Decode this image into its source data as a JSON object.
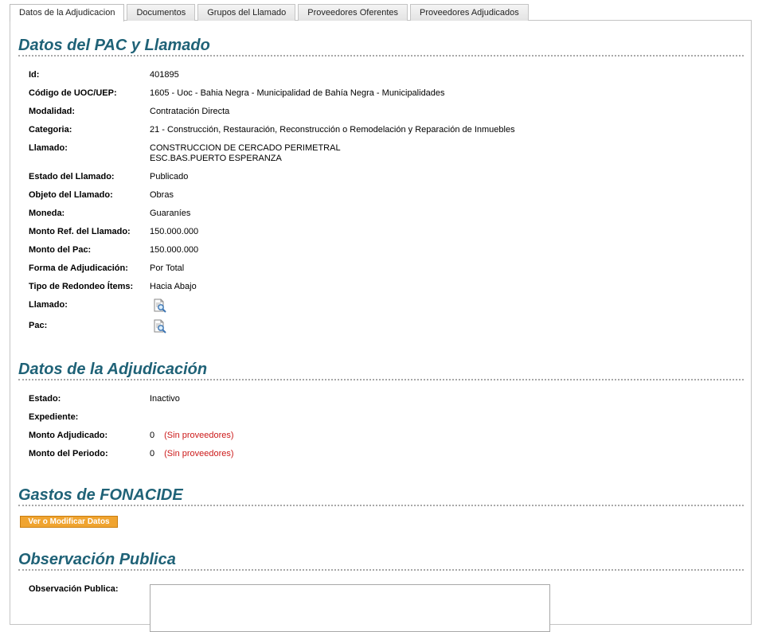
{
  "tabs": [
    {
      "label": "Datos de la Adjudicacion",
      "active": true
    },
    {
      "label": "Documentos"
    },
    {
      "label": "Grupos del Llamado"
    },
    {
      "label": "Proveedores Oferentes"
    },
    {
      "label": "Proveedores Adjudicados"
    }
  ],
  "pac": {
    "title": "Datos del PAC y Llamado",
    "fields": [
      {
        "label": "Id:",
        "value": "401895"
      },
      {
        "label": "Código de UOC/UEP:",
        "value": "1605 - Uoc - Bahia Negra - Municipalidad de Bahía Negra - Municipalidades"
      },
      {
        "label": "Modalidad:",
        "value": "Contratación Directa"
      },
      {
        "label": "Categoria:",
        "value": "21 - Construcción, Restauración, Reconstrucción o Remodelación y Reparación de Inmuebles"
      },
      {
        "label": "Llamado:",
        "value": "CONSTRUCCION DE CERCADO PERIMETRAL",
        "value2": "ESC.BAS.PUERTO ESPERANZA"
      },
      {
        "label": "Estado del Llamado:",
        "value": "Publicado"
      },
      {
        "label": "Objeto del Llamado:",
        "value": "Obras"
      },
      {
        "label": "Moneda:",
        "value": "Guaraníes"
      },
      {
        "label": "Monto Ref. del Llamado:",
        "value": "150.000.000"
      },
      {
        "label": "Monto del Pac:",
        "value": "150.000.000"
      },
      {
        "label": "Forma de Adjudicación:",
        "value": "Por Total"
      },
      {
        "label": "Tipo de Redondeo Ítems:",
        "value": "Hacia Abajo"
      },
      {
        "label": "Llamado:",
        "icon": "document-search-icon"
      },
      {
        "label": "Pac:",
        "icon": "document-search-icon"
      }
    ]
  },
  "adjudicacion": {
    "title": "Datos de la Adjudicación",
    "fields": [
      {
        "label": "Estado:",
        "value": "Inactivo"
      },
      {
        "label": "Expediente:",
        "value": ""
      },
      {
        "label": "Monto Adjudicado:",
        "value": "0",
        "note": "(Sin proveedores)"
      },
      {
        "label": "Monto del Periodo:",
        "value": "0",
        "note": "(Sin proveedores)"
      }
    ]
  },
  "fonacide": {
    "title": "Gastos de FONACIDE",
    "button_label": "Ver o Modificar Datos"
  },
  "observacion": {
    "title": "Observación Publica",
    "label": "Observación Publica:",
    "value": ""
  },
  "colors": {
    "section_title": "#1f6277",
    "note_red": "#cc1a1a",
    "button_orange": "#f0a430"
  }
}
